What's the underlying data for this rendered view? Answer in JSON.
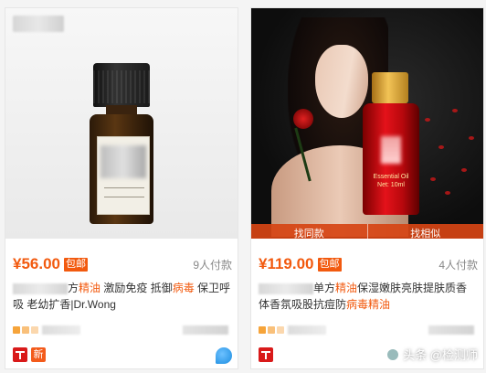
{
  "products": [
    {
      "price": "¥56.00",
      "free_shipping": "包邮",
      "paid_count": "9人付款",
      "title_parts": [
        {
          "text": "方",
          "hl": false
        },
        {
          "text": "精油",
          "hl": true
        },
        {
          "text": " 激励免疫 抵御",
          "hl": false
        },
        {
          "text": "病毒",
          "hl": true
        },
        {
          "text": " 保卫呼吸 老幼扩香|Dr.Wong",
          "hl": false
        }
      ],
      "badge_new": "新"
    },
    {
      "price": "¥119.00",
      "free_shipping": "包邮",
      "paid_count": "4人付款",
      "find_same": "找同款",
      "find_similar": "找相似",
      "bottle_label": "Essential Oil",
      "bottle_size": "Net: 10ml",
      "title_parts": [
        {
          "text": "单方",
          "hl": false
        },
        {
          "text": "精油",
          "hl": true
        },
        {
          "text": "保湿嫩肤亮肤提肤质香体",
          "hl": false
        },
        {
          "text": "香氛吸股抗痘防",
          "hl": false
        },
        {
          "text": "病毒精油",
          "hl": true
        }
      ]
    }
  ],
  "watermark": "头条 @检测师",
  "colors": {
    "accent": "#f25a0f",
    "tmall_red": "#d91a1a",
    "wangwang_blue": "#1c8de0"
  }
}
